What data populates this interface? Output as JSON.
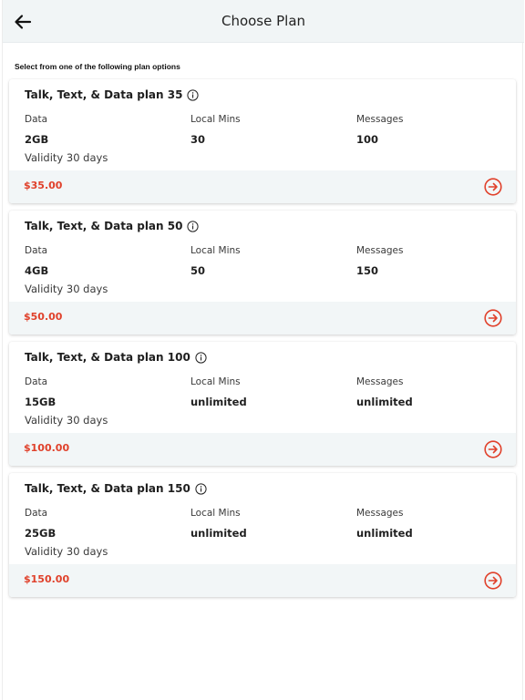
{
  "header": {
    "title": "Choose Plan",
    "back_icon": "arrow-left-icon"
  },
  "instructions": "Select from one of the following plan options",
  "colors": {
    "price": "#e0412b",
    "footer_bg": "#f2f6f7",
    "header_bg": "#f1f5f6"
  },
  "plans": [
    {
      "title": "Talk, Text, & Data plan 35",
      "data_label": "Data",
      "data_value": "2GB",
      "mins_label": "Local Mins",
      "mins_value": "30",
      "msgs_label": "Messages",
      "msgs_value": "100",
      "validity": "Validity 30 days",
      "price": "$35.00"
    },
    {
      "title": "Talk, Text, & Data plan 50",
      "data_label": "Data",
      "data_value": "4GB",
      "mins_label": "Local Mins",
      "mins_value": "50",
      "msgs_label": "Messages",
      "msgs_value": "150",
      "validity": "Validity 30 days",
      "price": "$50.00"
    },
    {
      "title": "Talk, Text, & Data plan 100",
      "data_label": "Data",
      "data_value": "15GB",
      "mins_label": "Local Mins",
      "mins_value": "unlimited",
      "msgs_label": "Messages",
      "msgs_value": "unlimited",
      "validity": "Validity 30 days",
      "price": "$100.00"
    },
    {
      "title": "Talk, Text, & Data plan 150",
      "data_label": "Data",
      "data_value": "25GB",
      "mins_label": "Local Mins",
      "mins_value": "unlimited",
      "msgs_label": "Messages",
      "msgs_value": "unlimited",
      "validity": "Validity 30 days",
      "price": "$150.00"
    }
  ]
}
